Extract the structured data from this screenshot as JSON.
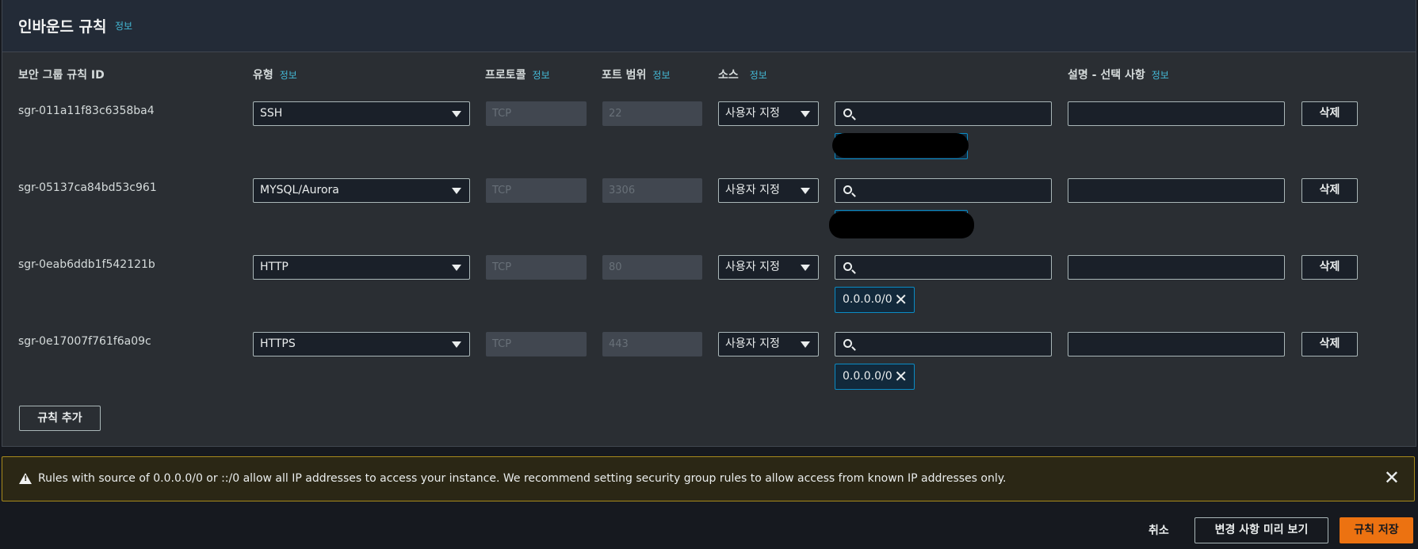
{
  "panel": {
    "title": "인바운드 규칙",
    "info": "정보"
  },
  "columns": {
    "id": "보안 그룹 규칙 ID",
    "type": "유형",
    "type_info": "정보",
    "protocol": "프로토콜",
    "protocol_info": "정보",
    "port": "포트 범위",
    "port_info": "정보",
    "source": "소스",
    "source_info": "정보",
    "desc": "설명 - 선택 사항",
    "desc_info": "정보"
  },
  "rules": [
    {
      "id": "sgr-011a11f83c6358ba4",
      "type": "SSH",
      "protocol": "TCP",
      "port": "22",
      "source_mode": "사용자 지정",
      "delete": "삭제",
      "token": "",
      "redacted": true
    },
    {
      "id": "sgr-05137ca84bd53c961",
      "type": "MYSQL/Aurora",
      "protocol": "TCP",
      "port": "3306",
      "source_mode": "사용자 지정",
      "delete": "삭제",
      "token": "",
      "redacted": true
    },
    {
      "id": "sgr-0eab6ddb1f542121b",
      "type": "HTTP",
      "protocol": "TCP",
      "port": "80",
      "source_mode": "사용자 지정",
      "delete": "삭제",
      "token": "0.0.0.0/0",
      "redacted": false
    },
    {
      "id": "sgr-0e17007f761f6a09c",
      "type": "HTTPS",
      "protocol": "TCP",
      "port": "443",
      "source_mode": "사용자 지정",
      "delete": "삭제",
      "token": "0.0.0.0/0",
      "redacted": false
    }
  ],
  "add_rule": "규칙 추가",
  "warning": {
    "text": "Rules with source of 0.0.0.0/0 or ::/0 allow all IP addresses to access your instance. We recommend setting security group rules to allow access from known IP addresses only."
  },
  "footer": {
    "cancel": "취소",
    "preview": "변경 사항 미리 보기",
    "save": "규칙 저장"
  },
  "colors": {
    "accent": "#ec7211",
    "info_link": "#44b9d6",
    "token_border": "#0a8bc4",
    "warning_border": "#a78a1c"
  }
}
